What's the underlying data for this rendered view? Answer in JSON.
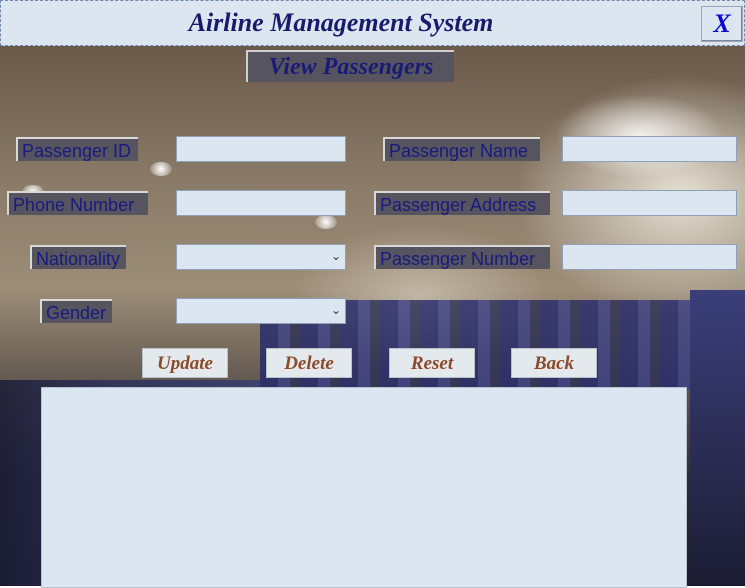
{
  "window": {
    "title": "Airline Management System",
    "close_label": "X"
  },
  "page": {
    "heading": "View Passengers"
  },
  "form": {
    "passenger_id": {
      "label": "Passenger ID",
      "value": ""
    },
    "passenger_name": {
      "label": "Passenger Name",
      "value": ""
    },
    "phone_number": {
      "label": "Phone Number",
      "value": ""
    },
    "passenger_address": {
      "label": "Passenger Address",
      "value": ""
    },
    "nationality": {
      "label": "Nationality",
      "value": ""
    },
    "passenger_number": {
      "label": "Passenger Number",
      "value": ""
    },
    "gender": {
      "label": "Gender",
      "value": ""
    }
  },
  "buttons": {
    "update": "Update",
    "delete": "Delete",
    "reset": "Reset",
    "back": "Back"
  },
  "colors": {
    "panel": "#dbe6f1",
    "label_bg": "#55545f",
    "label_text": "#1a1a80",
    "title_text": "#1a1a6b",
    "button_text": "#8b4a2a",
    "close_text": "#0a0acc"
  },
  "icons": {
    "close": "close-icon",
    "dropdown": "chevron-down-icon"
  }
}
